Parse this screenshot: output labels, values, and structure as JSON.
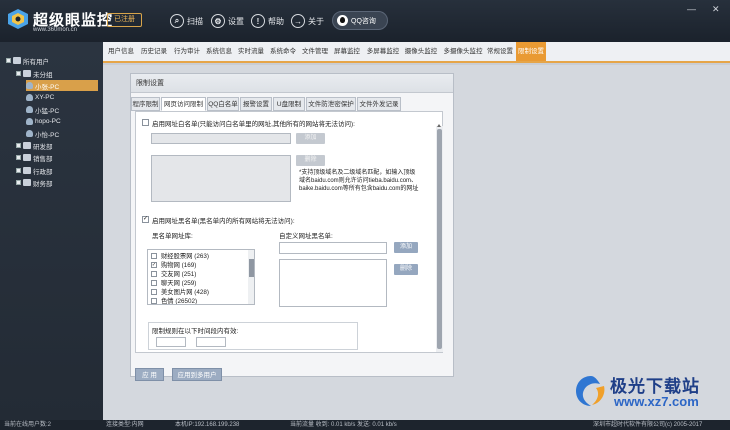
{
  "header": {
    "app_name": "超级眼监控",
    "url": "www.360mon.cn",
    "reg_badge": "已注册",
    "scan_label": "扫描",
    "settings_label": "设置",
    "help_label": "帮助",
    "about_label": "关于",
    "qq_label": "QQ咨询"
  },
  "tree": {
    "all_users": "所有用户",
    "groups": [
      {
        "label": "未分组"
      },
      {
        "label": "研发部"
      },
      {
        "label": "销售部"
      },
      {
        "label": "行政部"
      },
      {
        "label": "财务部"
      }
    ],
    "pcs": [
      "小张-PC",
      "XY-PC",
      "小猛-PC",
      "hopo-PC",
      "小怡-PC"
    ]
  },
  "tabs": [
    "用户信息",
    "历史记录",
    "行为审计",
    "系统信息",
    "实时流量",
    "系统命令",
    "文件管理",
    "屏幕监控",
    "多屏幕监控",
    "摄像头监控",
    "多摄像头监控",
    "常规设置",
    "限制设置"
  ],
  "panel": {
    "title": "限制设置",
    "subtabs": [
      "程序限制",
      "网页访问限制",
      "QQ白名单",
      "报警设置",
      "U盘限制",
      "文件防泄密保护",
      "文件外发记录"
    ],
    "whitelist_label": "启用网址白名单(只能访问白名单里的网址,其他所有的网站将无法访问):",
    "add_label": "添加",
    "delete_label": "删除",
    "note": "*支持顶级域名及二级域名匹配，如输入顶级域名baidu.com则允许访问tieba.baidu.com、baike.baidu.com等所有包含baidu.com的网址",
    "blacklist_label": "启用网址黑名单(黑名单内的所有网站将无法访问):",
    "blacklist_lib_label": "黑名单网址库:",
    "custom_label": "自定义网址黑名单:",
    "blacklist_items": [
      {
        "label": "财经股票网 (263)",
        "checked": false
      },
      {
        "label": "购物网 (169)",
        "checked": true
      },
      {
        "label": "交友网 (251)",
        "checked": false
      },
      {
        "label": "聊天网 (259)",
        "checked": false
      },
      {
        "label": "美女图片网 (428)",
        "checked": false
      },
      {
        "label": "色情 (26502)",
        "checked": false
      }
    ],
    "time_label": "限制规则在以下时间段内有效:",
    "apply_label": "应 用",
    "apply_multi_label": "应用到多用户"
  },
  "status": {
    "online": "当前在线用户数:2",
    "conn": "连接类型:内网",
    "ip": "本机IP:192.168.199.238",
    "traffic": "当前流量 收到: 0.01 kb/s   发送: 0.01 kb/s",
    "copyright": "深圳市超时代软件有限公司(c) 2005-2017"
  },
  "watermark": {
    "title": "极光下载站",
    "url": "www.xz7.com"
  },
  "colors": {
    "accent": "#e99a33",
    "header_bg": "#27303c",
    "button": "#95a7bf"
  }
}
